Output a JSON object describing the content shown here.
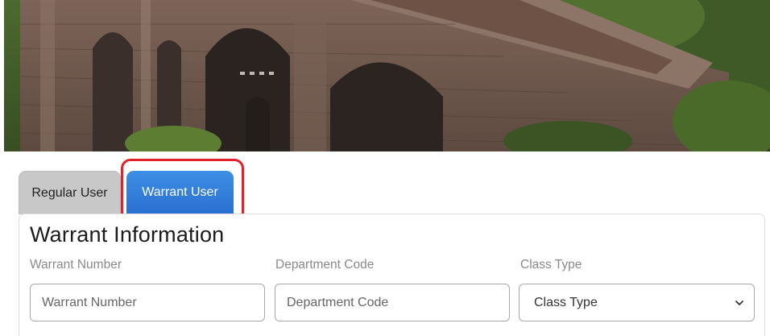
{
  "hero": {
    "dots_icon": "carousel-dots"
  },
  "tabs": [
    {
      "label": "Regular User",
      "active": false
    },
    {
      "label": "Warrant User",
      "active": true
    }
  ],
  "form": {
    "title": "Warrant Information",
    "fields": [
      {
        "label": "Warrant Number",
        "placeholder": "Warrant Number"
      },
      {
        "label": "Department Code",
        "placeholder": "Department Code"
      },
      {
        "label": "Class Type",
        "selected": "Class Type"
      }
    ]
  },
  "colors": {
    "active_tab": "#2f7ad9",
    "inactive_tab": "#c8c8c8",
    "highlight": "#e3212b"
  }
}
